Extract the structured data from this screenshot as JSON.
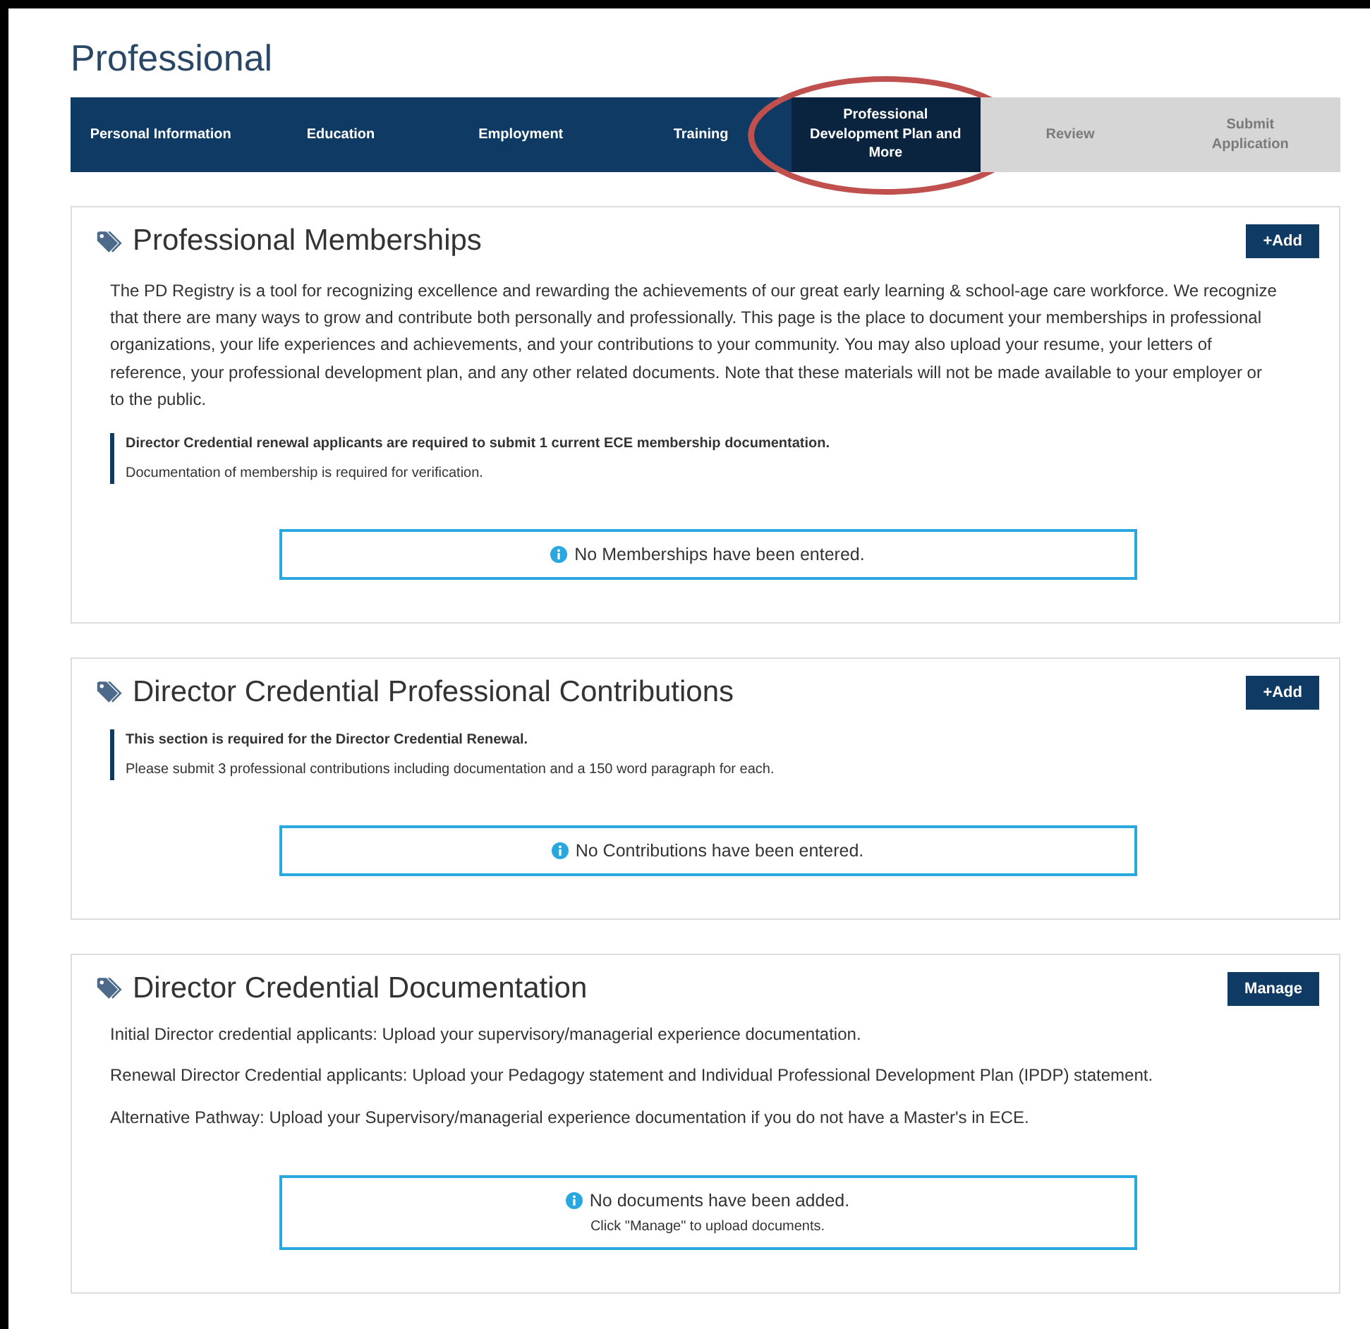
{
  "page_title": "Professional",
  "tabs": [
    {
      "label": "Personal Information",
      "selected": false,
      "disabled": false,
      "circled": false
    },
    {
      "label": "Education",
      "selected": false,
      "disabled": false,
      "circled": false
    },
    {
      "label": "Employment",
      "selected": false,
      "disabled": false,
      "circled": false
    },
    {
      "label": "Training",
      "selected": false,
      "disabled": false,
      "circled": false
    },
    {
      "label": "Professional Development Plan and More",
      "selected": true,
      "disabled": false,
      "circled": true
    },
    {
      "label": "Review",
      "selected": false,
      "disabled": true,
      "circled": false
    },
    {
      "label": "Submit Application",
      "selected": false,
      "disabled": true,
      "circled": false
    }
  ],
  "sections": [
    {
      "title": "Professional Memberships",
      "button": "+Add",
      "paragraphs": [
        "The PD Registry is a tool for recognizing excellence and rewarding the achievements of our great early learning & school-age care workforce. We recognize that there are many ways to grow and contribute both personally and professionally. This page is the place to document your memberships in professional organizations, your life experiences and achievements, and your contributions to your community. You may also upload your resume, your letters of reference, your professional development plan, and any other related documents. Note that these materials will not be made available to your employer or to the public."
      ],
      "note": {
        "heading": "Director Credential renewal applicants are required to submit 1 current ECE membership documentation.",
        "text": "Documentation of membership is required for verification."
      },
      "empty": {
        "message": "No Memberships have been entered."
      }
    },
    {
      "title": "Director Credential Professional Contributions",
      "button": "+Add",
      "note": {
        "heading": "This section is required for the Director Credential Renewal.",
        "text": "Please submit 3 professional contributions including documentation and a 150 word paragraph for each."
      },
      "empty": {
        "message": "No Contributions have been entered."
      }
    },
    {
      "title": "Director Credential Documentation",
      "button": "Manage",
      "paragraphs": [
        "Initial Director credential applicants: Upload your supervisory/managerial experience documentation.",
        "Renewal Director Credential applicants: Upload your Pedagogy statement and Individual Professional Development Plan (IPDP) statement.",
        "Alternative Pathway: Upload your Supervisory/managerial experience documentation if you do not have a Master's in ECE."
      ],
      "empty": {
        "message": "No documents have been added.",
        "hint": "Click \"Manage\" to upload documents."
      }
    }
  ]
}
